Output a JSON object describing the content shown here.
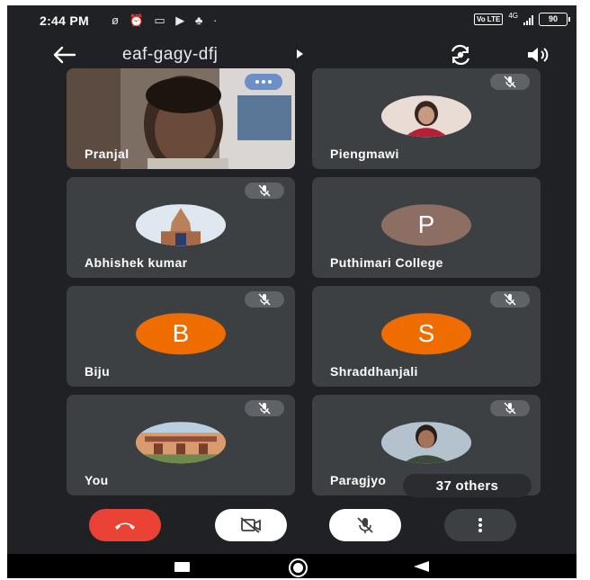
{
  "status_bar": {
    "time": "2:44 PM",
    "left_icons": "ø ⏰ ▭ ▶ ♣ ·",
    "volte": "Vo LTE",
    "network": "4G",
    "battery": "90"
  },
  "header": {
    "meeting_code": "eaf-gagy-dfj"
  },
  "tiles": [
    {
      "name": "Pranjal",
      "avatar_type": "video"
    },
    {
      "name": "Piengmawi",
      "avatar_type": "photo"
    },
    {
      "name": "Abhishek kumar",
      "avatar_type": "photo"
    },
    {
      "name": "Puthimari College",
      "avatar_type": "letter",
      "letter": "P",
      "color": "#8d6e63"
    },
    {
      "name": "Biju",
      "avatar_type": "letter",
      "letter": "B",
      "color": "#ef6c00"
    },
    {
      "name": "Shraddhanjali",
      "avatar_type": "letter",
      "letter": "S",
      "color": "#ef6c00"
    },
    {
      "name": "You",
      "avatar_type": "photo"
    },
    {
      "name": "Paragjyo",
      "avatar_type": "photo"
    }
  ],
  "others_chip": "37 others",
  "colors": {
    "background": "#202124",
    "tile": "#3c4043",
    "end_call": "#ea4335",
    "mic_badge": "#5f6368",
    "speaking_badge": "#6d8fc7"
  },
  "icons": {
    "back": "arrow-left-icon",
    "switch_camera": "switch-camera-icon",
    "speaker": "speaker-icon",
    "mic_off": "mic-off-icon",
    "end_call": "phone-hangup-icon",
    "camera_off": "camera-off-icon",
    "more": "more-vert-icon"
  }
}
